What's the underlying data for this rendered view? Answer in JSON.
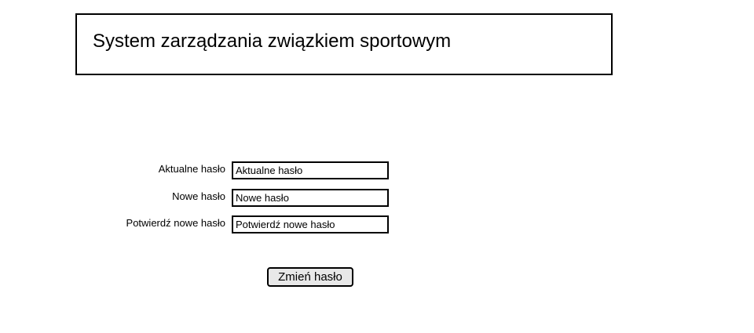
{
  "header": {
    "title": "System zarządzania związkiem sportowym"
  },
  "form": {
    "fields": [
      {
        "label": "Aktualne hasło",
        "placeholder": "Aktualne hasło",
        "value": ""
      },
      {
        "label": "Nowe hasło",
        "placeholder": "Nowe hasło",
        "value": ""
      },
      {
        "label": "Potwierdź nowe hasło",
        "placeholder": "Potwierdź nowe hasło",
        "value": ""
      }
    ],
    "submit_label": "Zmień hasło"
  }
}
